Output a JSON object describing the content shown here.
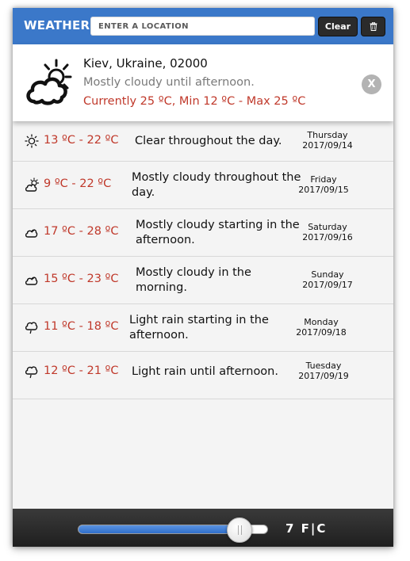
{
  "header": {
    "brand": "WEATHER",
    "search_placeholder": "ENTER A LOCATION",
    "clear_label": "Clear"
  },
  "current": {
    "location": "Kiev, Ukraine, 02000",
    "summary": "Mostly cloudy until afternoon.",
    "temps": "Currently 25 ºC, Min 12 ºC - Max 25 ºC",
    "close_label": "X",
    "icon": "partly-cloudy-day-icon"
  },
  "forecast": [
    {
      "icon": "clear-day-icon",
      "temp": "13 ºC - 22 ºC",
      "summary": "Clear throughout the day.",
      "day": "Thursday",
      "date": "2017/09/14"
    },
    {
      "icon": "partly-cloudy-day-icon",
      "temp": "9 ºC - 22 ºC",
      "summary": "Mostly cloudy throughout the day.",
      "day": "Friday",
      "date": "2017/09/15"
    },
    {
      "icon": "cloudy-icon",
      "temp": "17 ºC - 28 ºC",
      "summary": "Mostly cloudy starting in the afternoon.",
      "day": "Saturday",
      "date": "2017/09/16"
    },
    {
      "icon": "cloudy-icon",
      "temp": "15 ºC - 23 ºC",
      "summary": "Mostly cloudy in the morning.",
      "day": "Sunday",
      "date": "2017/09/17"
    },
    {
      "icon": "rain-icon",
      "temp": "11 ºC - 18 ºC",
      "summary": "Light rain starting in the afternoon.",
      "day": "Monday",
      "date": "2017/09/18"
    },
    {
      "icon": "rain-icon",
      "temp": "12 ºC - 21 ºC",
      "summary": "Light rain until afternoon.",
      "day": "Tuesday",
      "date": "2017/09/19"
    }
  ],
  "footer": {
    "slider_level": 0.85,
    "count": "7",
    "unit_toggle": "F|C"
  },
  "colors": {
    "header_blue": "#3b78c9",
    "temp_red": "#c0392b",
    "summary_grey": "#7a7a7a"
  }
}
